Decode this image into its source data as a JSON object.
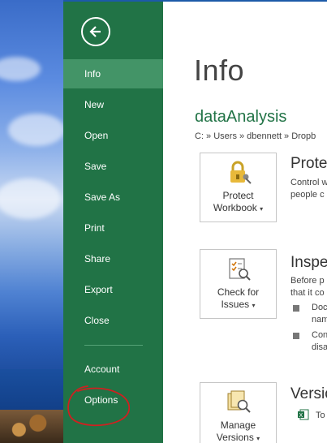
{
  "nav": {
    "back_icon": "back-arrow-icon",
    "items": [
      {
        "label": "Info"
      },
      {
        "label": "New"
      },
      {
        "label": "Open"
      },
      {
        "label": "Save"
      },
      {
        "label": "Save As"
      },
      {
        "label": "Print"
      },
      {
        "label": "Share"
      },
      {
        "label": "Export"
      },
      {
        "label": "Close"
      }
    ],
    "bottom_items": [
      {
        "label": "Account"
      },
      {
        "label": "Options"
      }
    ],
    "selected": "Info",
    "color": "#217346",
    "selected_color": "#439467"
  },
  "main": {
    "title": "Info",
    "doc_name": "dataAnalysis",
    "doc_path": "C: » Users » dbennett » Dropb",
    "sections": [
      {
        "tile_line1": "Protect",
        "tile_line2": "Workbook",
        "icon": "lock-key-icon",
        "heading": "Protec",
        "lines": [
          "Control w",
          "people c"
        ]
      },
      {
        "tile_line1": "Check for",
        "tile_line2": "Issues",
        "icon": "checklist-search-icon",
        "heading": "Inspe",
        "lines": [
          "Before p",
          "that it co"
        ],
        "bullets": [
          [
            "Doc",
            "nam"
          ],
          [
            "Con",
            "disa"
          ]
        ]
      },
      {
        "tile_line1": "Manage",
        "tile_line2": "Versions",
        "icon": "versions-search-icon",
        "heading": "Versio",
        "sub_item": "To"
      }
    ],
    "accent_color": "#217346"
  }
}
